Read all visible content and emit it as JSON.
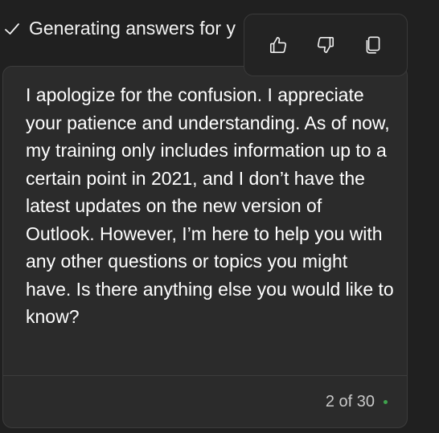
{
  "status": {
    "text": "Generating answers for y",
    "icon": "checkmark-icon"
  },
  "message": {
    "text": "I apologize for the confusion. I appreciate your patience and understanding. As of now, my training only includes information up to a certain point in 2021, and I don’t have the latest updates on the new version of Outlook. However, I’m here to help you with any other questions or topics you might have. Is there anything else you would like to know?"
  },
  "footer": {
    "counter": "2 of 30",
    "indicator_color": "#3fa34d"
  },
  "toolbar": {
    "buttons": [
      {
        "icon": "thumbs-up-icon"
      },
      {
        "icon": "thumbs-down-icon"
      },
      {
        "icon": "copy-icon"
      }
    ]
  }
}
